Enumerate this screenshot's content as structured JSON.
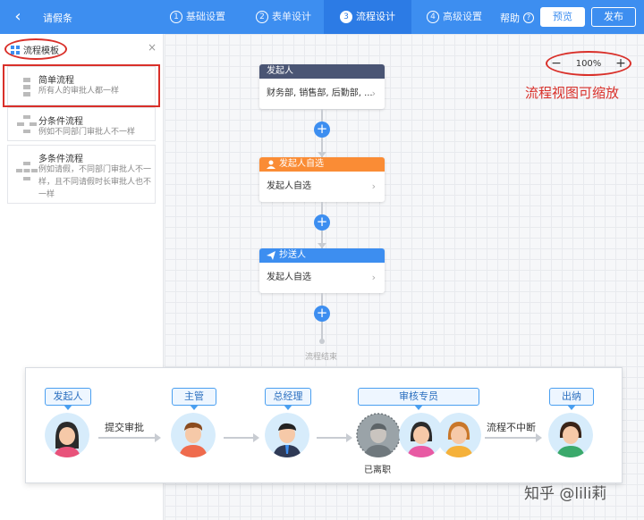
{
  "topbar": {
    "back_icon": "chevron-left-icon",
    "app_title": "请假条",
    "steps": [
      {
        "num": "1",
        "label": "基础设置"
      },
      {
        "num": "2",
        "label": "表单设计"
      },
      {
        "num": "3",
        "label": "流程设计"
      },
      {
        "num": "4",
        "label": "高级设置"
      }
    ],
    "help_label": "帮助",
    "help_icon": "?",
    "preview_label": "预览",
    "publish_label": "发布",
    "color": "#3d8ef0"
  },
  "sidebar": {
    "title": "流程模板",
    "close": "×",
    "templates": [
      {
        "name": "简单流程",
        "desc": "所有人的审批人都一样"
      },
      {
        "name": "分条件流程",
        "desc": "例如不同部门审批人不一样"
      },
      {
        "name": "多条件流程",
        "desc": "例如请假，不同部门审批人不一样，且不同请假时长审批人也不一样"
      }
    ]
  },
  "canvas": {
    "zoom": {
      "minus": "−",
      "value": "100%",
      "plus": "+"
    },
    "zoom_hint": "流程视图可缩放",
    "nodes": [
      {
        "title": "发起人",
        "body": "财务部, 销售部, 后勤部, ...",
        "color": "#4a5574"
      },
      {
        "title": "发起人自选",
        "body": "发起人自选",
        "color": "#fa8c35"
      },
      {
        "title": "抄送人",
        "body": "发起人自选",
        "color": "#3d8ef0"
      }
    ],
    "chevron": "›",
    "add": "+",
    "end_label": "流程结束"
  },
  "illustration": {
    "roles": [
      "发起人",
      "主管",
      "总经理",
      "审核专员",
      "出纳"
    ],
    "submit_label": "提交审批",
    "continue_label": "流程不中断",
    "left_label": "已离职"
  },
  "watermark": "知乎 @lili莉"
}
